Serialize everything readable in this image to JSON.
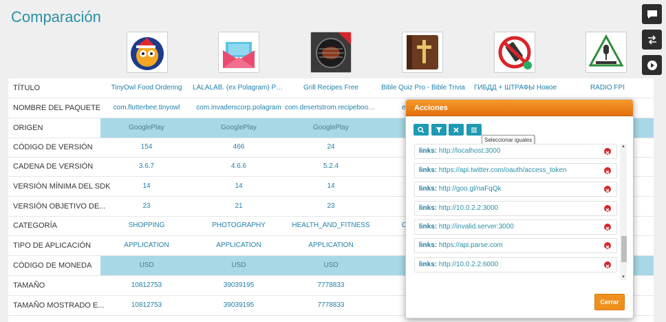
{
  "page": {
    "title": "Comparación"
  },
  "apps": [
    {
      "icon": "owl-app-icon"
    },
    {
      "icon": "envelope-app-icon"
    },
    {
      "icon": "grill-app-icon"
    },
    {
      "icon": "bible-app-icon"
    },
    {
      "icon": "no-phone-app-icon"
    },
    {
      "icon": "radio-app-icon"
    }
  ],
  "rows": [
    {
      "label": "TÍTULO",
      "highlight": false,
      "cells": [
        "TinyOwl Food Ordering",
        "LALALAB. (ex Polagram) Print",
        "Grill Recipes Free",
        "Bible Quiz Pro - Bible Trivia",
        "ГИБДД + ШТРАФЫ Новое",
        "RADIO FPI"
      ]
    },
    {
      "label": "NOMBRE DEL PAQUETE",
      "highlight": false,
      "cells": [
        "com.flutterbee.tinyowl",
        "com.invaderscorp.polagram",
        "com.desertstrom.recipebook...",
        "e"
      ]
    },
    {
      "label": "ORIGEN",
      "highlight": true,
      "cells": [
        "GooglePlay",
        "GooglePlay",
        "GooglePlay"
      ]
    },
    {
      "label": "CÓDIGO DE VERSIÓN",
      "highlight": false,
      "cells": [
        "154",
        "466",
        "24"
      ]
    },
    {
      "label": "CADENA DE VERSIÓN",
      "highlight": false,
      "cells": [
        "3.6.7",
        "4.6.6",
        "5.2.4"
      ]
    },
    {
      "label": "VERSIÓN MÍNIMA DEL SDK",
      "highlight": false,
      "cells": [
        "14",
        "14",
        "14"
      ]
    },
    {
      "label": "VERSIÓN OBJETIVO DE...",
      "highlight": false,
      "cells": [
        "23",
        "21",
        "23"
      ]
    },
    {
      "label": "CATEGORÍA",
      "highlight": false,
      "cells": [
        "SHOPPING",
        "PHOTOGRAPHY",
        "HEALTH_AND_FITNESS",
        "C"
      ]
    },
    {
      "label": "TIPO DE APLICACIÓN",
      "highlight": false,
      "cells": [
        "APPLICATION",
        "APPLICATION",
        "APPLICATION"
      ]
    },
    {
      "label": "CÓDIGO DE MONEDA",
      "highlight": true,
      "cells": [
        "USD",
        "USD",
        "USD"
      ]
    },
    {
      "label": "TAMAÑO",
      "highlight": false,
      "cells": [
        "10812753",
        "39039195",
        "7778833"
      ]
    },
    {
      "label": "TAMAÑO MOSTRADO E...",
      "highlight": false,
      "cells": [
        "10812753",
        "39039195",
        "7778833"
      ]
    }
  ],
  "side_buttons": [
    "chat-icon",
    "swap-icon",
    "play-icon"
  ],
  "modal": {
    "title": "Acciones",
    "tools": [
      "search-icon",
      "filter-icon",
      "clear-icon",
      "list-icon"
    ],
    "tooltip": "Seleccionar iguales",
    "items": [
      {
        "key": "links:",
        "value": "http://localhost:3000"
      },
      {
        "key": "links:",
        "value": "https://api.twitter.com/oauth/access_token"
      },
      {
        "key": "links:",
        "value": "http://goo.gl/naFqQk"
      },
      {
        "key": "links:",
        "value": "http://10.0.2.2:3000"
      },
      {
        "key": "links:",
        "value": "http://invalid.server:3000"
      },
      {
        "key": "links:",
        "value": "https://api.parse.com"
      },
      {
        "key": "links:",
        "value": "http://10.0.2.2:6000"
      }
    ],
    "close_label": "Cerrar"
  },
  "colors": {
    "accent": "#2a8fa8",
    "header_orange": "#f0901c",
    "highlight_row": "#a8d8e6",
    "delete_red": "#d9252a"
  }
}
